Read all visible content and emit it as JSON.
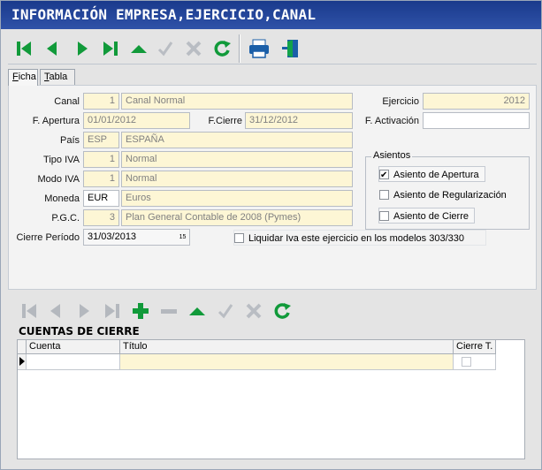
{
  "window": {
    "title": "INFORMACIÓN EMPRESA,EJERCICIO,CANAL"
  },
  "tabs": [
    {
      "label_u": "F",
      "label_rest": "icha"
    },
    {
      "label_u": "T",
      "label_rest": "abla"
    }
  ],
  "form": {
    "canal_label": "Canal",
    "canal_code": "1",
    "canal_name": "Canal Normal",
    "apertura_label": "F. Apertura",
    "apertura_value": "01/01/2012",
    "cierre_label": "F.Cierre",
    "cierre_value": "31/12/2012",
    "pais_label": "País",
    "pais_code": "ESP",
    "pais_name": "ESPAÑA",
    "tipo_iva_label": "Tipo IVA",
    "tipo_iva_code": "1",
    "tipo_iva_name": "Normal",
    "modo_iva_label": "Modo IVA",
    "modo_iva_code": "1",
    "modo_iva_name": "Normal",
    "moneda_label": "Moneda",
    "moneda_code": "EUR",
    "moneda_name": "Euros",
    "pgc_label": "P.G.C.",
    "pgc_code": "3",
    "pgc_name": "Plan General Contable de 2008 (Pymes)",
    "cierre_periodo_label": "Cierre Período",
    "cierre_periodo_value": "31/03/2013",
    "ejercicio_label": "Ejercicio",
    "ejercicio_value": "2012",
    "activacion_label": "F. Activación",
    "activacion_value": "",
    "liquidar_label": "Liquidar Iva este ejercicio en los modelos 303/330",
    "liquidar_checked": false
  },
  "asientos": {
    "title": "Asientos",
    "apertura_label": "Asiento de Apertura",
    "apertura_checked": true,
    "regularizacion_label": "Asiento de Regularización",
    "regularizacion_checked": false,
    "cierre_label": "Asiento de Cierre",
    "cierre_checked": false
  },
  "cuentas_cierre": {
    "title": "CUENTAS DE CIERRE",
    "columns": [
      "Cuenta",
      "Título",
      "Cierre T."
    ],
    "rows": [
      {
        "cuenta": "",
        "titulo": "",
        "cierre_t": false
      }
    ]
  },
  "toolbar_top_icons": [
    "first-icon",
    "prev-icon",
    "next-icon",
    "last-icon",
    "up-icon",
    "check-icon",
    "cancel-icon",
    "refresh-icon",
    "print-icon",
    "exit-door-icon"
  ],
  "toolbar_bottom_icons": [
    "first-icon",
    "prev-icon",
    "next-icon",
    "last-icon",
    "add-icon",
    "remove-icon",
    "up-icon",
    "check-icon",
    "cancel-icon",
    "refresh-icon"
  ],
  "colors": {
    "title_bg": "#1a3a8c",
    "green": "#119a3a",
    "readonly_field": "#fdf6d5",
    "highlight_ellipse": "#c0282d"
  }
}
